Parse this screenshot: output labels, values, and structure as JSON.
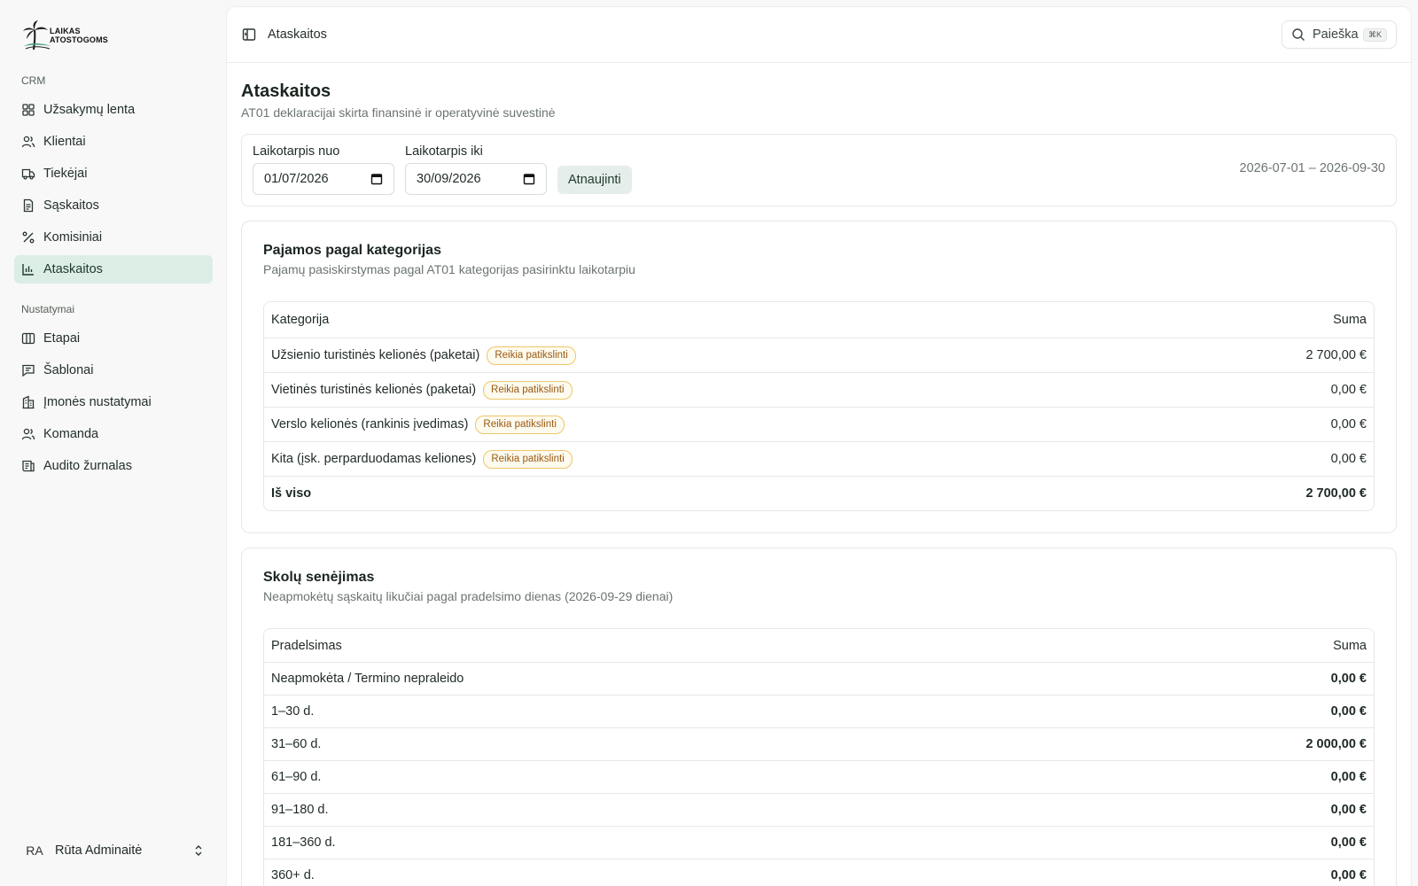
{
  "brand": {
    "line1": "LAIKAS",
    "line2": "ATOSTOGOMS"
  },
  "sidebar": {
    "crm_label": "CRM",
    "crm_items": [
      {
        "label": "Užsakymų lenta",
        "icon": "grid-icon"
      },
      {
        "label": "Klientai",
        "icon": "users-icon"
      },
      {
        "label": "Tiekėjai",
        "icon": "truck-icon"
      },
      {
        "label": "Sąskaitos",
        "icon": "receipt-icon"
      },
      {
        "label": "Komisiniai",
        "icon": "percent-icon"
      },
      {
        "label": "Ataskaitos",
        "icon": "bar-chart-icon",
        "active": true
      }
    ],
    "settings_label": "Nustatymai",
    "settings_items": [
      {
        "label": "Etapai",
        "icon": "columns-icon"
      },
      {
        "label": "Šablonai",
        "icon": "message-icon"
      },
      {
        "label": "Įmonės nustatymai",
        "icon": "building-icon"
      },
      {
        "label": "Komanda",
        "icon": "team-icon"
      },
      {
        "label": "Audito žurnalas",
        "icon": "log-icon"
      }
    ],
    "user": {
      "initials": "RA",
      "name": "Rūta Adminaitė"
    }
  },
  "topbar": {
    "breadcrumb": "Ataskaitos",
    "search_label": "Paieška",
    "search_shortcut": "⌘K"
  },
  "page": {
    "title": "Ataskaitos",
    "subtitle": "AT01 deklaracijai skirta finansinė ir operatyvinė suvestinė"
  },
  "filter": {
    "from_label": "Laikotarpis nuo",
    "from_value": "01/07/2026",
    "to_label": "Laikotarpis iki",
    "to_value": "30/09/2026",
    "refresh_label": "Atnaujinti",
    "period_text": "2026-07-01 – 2026-09-30"
  },
  "income": {
    "title": "Pajamos pagal kategorijas",
    "subtitle": "Pajamų pasiskirstymas pagal AT01 kategorijas pasirinktu laikotarpiu",
    "col_category": "Kategorija",
    "col_amount": "Suma",
    "rows": [
      {
        "name": "Užsienio turistinės kelionės (paketai)",
        "badge": "Reikia patikslinti",
        "amount": "2 700,00 €"
      },
      {
        "name": "Vietinės turistinės kelionės (paketai)",
        "badge": "Reikia patikslinti",
        "amount": "0,00 €"
      },
      {
        "name": "Verslo kelionės (rankinis įvedimas)",
        "badge": "Reikia patikslinti",
        "amount": "0,00 €"
      },
      {
        "name": "Kita (įsk. perparduodamas keliones)",
        "badge": "Reikia patikslinti",
        "amount": "0,00 €"
      }
    ],
    "total_label": "Iš viso",
    "total_amount": "2 700,00 €"
  },
  "aging": {
    "title": "Skolų senėjimas",
    "subtitle": "Neapmokėtų sąskaitų likučiai pagal pradelsimo dienas (2026-09-29 dienai)",
    "col_overdue": "Pradelsimas",
    "col_amount": "Suma",
    "rows": [
      {
        "name": "Neapmokėta / Termino nepraleido",
        "amount": "0,00 €"
      },
      {
        "name": "1–30 d.",
        "amount": "0,00 €"
      },
      {
        "name": "31–60 d.",
        "amount": "2 000,00 €"
      },
      {
        "name": "61–90 d.",
        "amount": "0,00 €"
      },
      {
        "name": "91–180 d.",
        "amount": "0,00 €"
      },
      {
        "name": "181–360 d.",
        "amount": "0,00 €"
      },
      {
        "name": "360+ d.",
        "amount": "0,00 €"
      }
    ]
  }
}
